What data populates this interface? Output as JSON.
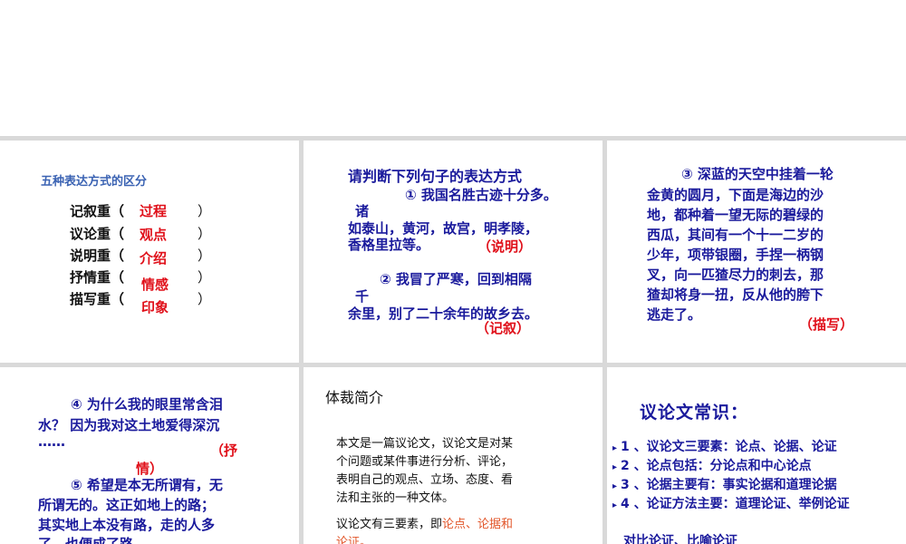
{
  "slide1": {
    "title": "五种表达方式的区分",
    "rows": [
      {
        "label": "记叙重（",
        "answer": "过程",
        "close": "）"
      },
      {
        "label": "议论重（",
        "answer": "观点",
        "close": "）"
      },
      {
        "label": "说明重（",
        "answer": "介绍",
        "close": "）"
      },
      {
        "label": "抒情重（",
        "answer": "情感",
        "close": "）"
      },
      {
        "label": "描写重（",
        "answer": "印象",
        "close": "）"
      }
    ]
  },
  "slide2": {
    "title": "请判断下列句子的表达方式",
    "q1_line1": "① 我国名胜古迹十分多。",
    "q1_line2": "诸",
    "q1_line3": "如泰山，黄河，故宫，明孝陵，",
    "q1_line4": "香格里拉等。",
    "q1_answer": "（说明）",
    "q2_line1": "② 我冒了严寒，回到相隔",
    "q2_line2": "千",
    "q2_line3": "余里，别了二十余年的故乡去。",
    "q2_answer": "（记叙）"
  },
  "slide3": {
    "lines": [
      "③ 深蓝的天空中挂着一轮",
      "金黄的圆月，下面是海边的沙",
      "地，都种着一望无际的碧绿的",
      "西瓜，其间有一个十一二岁的",
      "少年，项带银圈，手捏一柄钢",
      "叉，向一匹猹尽力的刺去，那",
      "猹却将身一扭，反从他的胯下",
      "逃走了。"
    ],
    "answer": "（描写）"
  },
  "slide4": {
    "q4_line1": "④ 为什么我的眼里常含泪",
    "q4_line2": "水？ 因为我对这土地爱得深沉",
    "q4_line3": "……",
    "answer_part1": "（抒",
    "answer_part2": "情）",
    "q5_line1": "⑤ 希望是本无所谓有，无",
    "q5_line2": "所谓无的。这正如地上的路；",
    "q5_line3": "其实地上本没有路，走的人多",
    "q5_line4": "了，也便成了路"
  },
  "slide5": {
    "title": "体裁简介",
    "para1": [
      "本文是一篇议论文，议论文是对某",
      "个问题或某件事进行分析、评论，",
      "表明自己的观点、立场、态度、看",
      "法和主张的一种文体。"
    ],
    "para2_prefix": "议论文有三要素，即",
    "para2_highlight1": "论点、论据和",
    "para2_highlight2": "论证。"
  },
  "slide6": {
    "title": "议论文常识：",
    "bullet_glyph": "▸",
    "items": [
      "1 、议论文三要素：论点、论据、论证",
      "2 、论点包括：分论点和中心论点",
      "3 、论据主要有：事实论据和道理论据",
      "4 、论证方法主要：道理论证、举例论证"
    ],
    "extra": "对比论证、比喻论证"
  }
}
